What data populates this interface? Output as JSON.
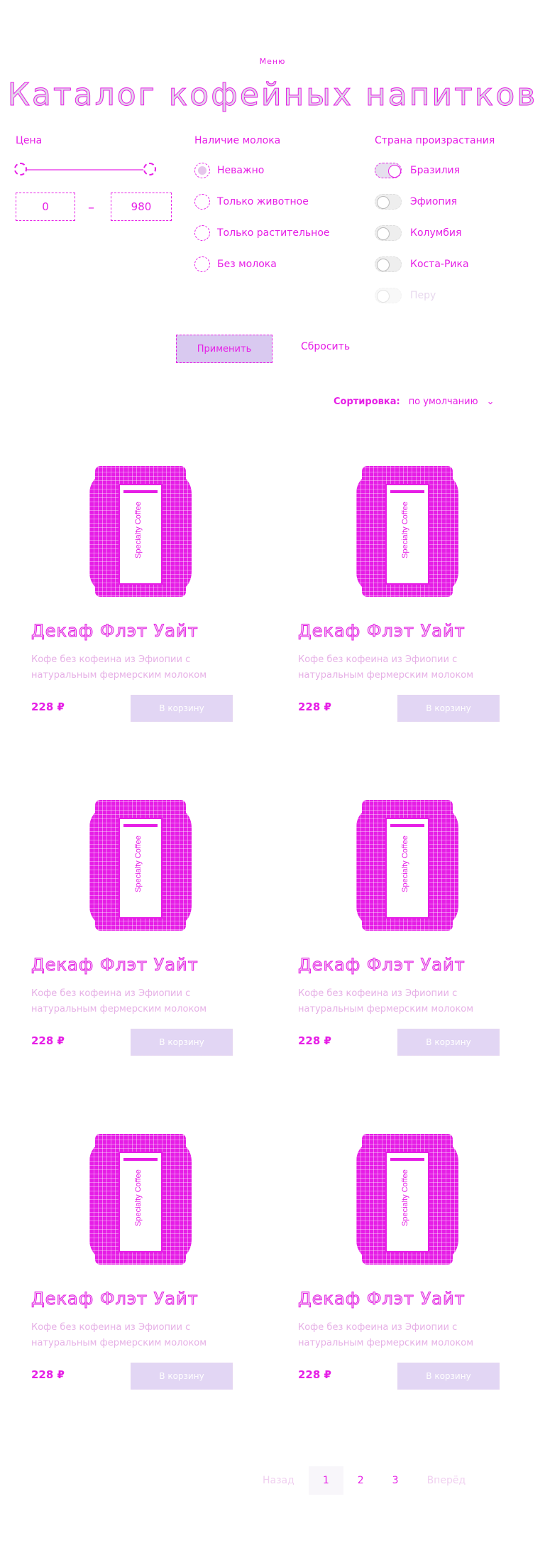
{
  "breadcrumb": "Меню",
  "title": "Каталог кофейных напитков",
  "filters": {
    "price": {
      "label": "Цена",
      "min": "0",
      "max": "980"
    },
    "milk": {
      "label": "Наличие молока",
      "options": [
        "Неважно",
        "Только животное",
        "Только растительное",
        "Без молока"
      ],
      "selected": 0
    },
    "country": {
      "label": "Страна произрастания",
      "options": [
        "Бразилия",
        "Эфиопия",
        "Колумбия",
        "Коста-Рика",
        "Перу"
      ],
      "on": [
        true,
        false,
        false,
        false,
        false
      ],
      "disabled": [
        false,
        false,
        false,
        false,
        true
      ]
    },
    "apply_label": "Применить",
    "reset_label": "Сбросить"
  },
  "sort": {
    "label": "Сортировка:",
    "value": "по умолчанию"
  },
  "products": [
    {
      "name": "Декаф Флэт Уайт",
      "desc": "Кофе без кофеина из Эфиопии с натуральным фермерским молоком",
      "price": "228 ₽",
      "button": "В корзину",
      "can_text": "Specialty Coffee"
    },
    {
      "name": "Декаф Флэт Уайт",
      "desc": "Кофе без кофеина из Эфиопии с натуральным фермерским молоком",
      "price": "228 ₽",
      "button": "В корзину",
      "can_text": "Specialty Coffee"
    },
    {
      "name": "Декаф Флэт Уайт",
      "desc": "Кофе без кофеина из Эфиопии с натуральным фермерским молоком",
      "price": "228 ₽",
      "button": "В корзину",
      "can_text": "Specialty Coffee"
    },
    {
      "name": "Декаф Флэт Уайт",
      "desc": "Кофе без кофеина из Эфиопии с натуральным фермерским молоком",
      "price": "228 ₽",
      "button": "В корзину",
      "can_text": "Specialty Coffee"
    },
    {
      "name": "Декаф Флэт Уайт",
      "desc": "Кофе без кофеина из Эфиопии с натуральным фермерским молоком",
      "price": "228 ₽",
      "button": "В корзину",
      "can_text": "Specialty Coffee"
    },
    {
      "name": "Декаф Флэт Уайт",
      "desc": "Кофе без кофеина из Эфиопии с натуральным фермерским молоком",
      "price": "228 ₽",
      "button": "В корзину",
      "can_text": "Specialty Coffee"
    }
  ],
  "pagination": {
    "prev": "Назад",
    "pages": [
      "1",
      "2",
      "3"
    ],
    "current": 0,
    "next": "Вперёд"
  },
  "colors": {
    "accent": "#e61ee6",
    "button_bg": "#d9c9f0"
  }
}
